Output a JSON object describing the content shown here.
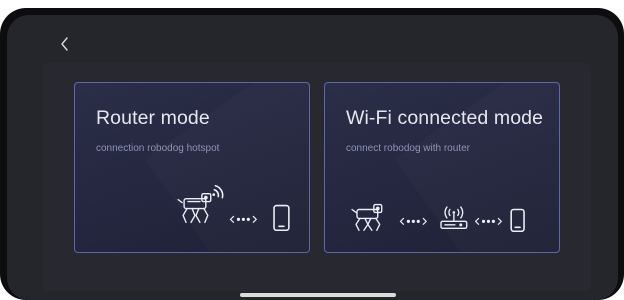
{
  "nav": {
    "back_icon": "chevron-left-icon"
  },
  "modes": [
    {
      "title": "Router mode",
      "subtitle": "connection robodog hotspot",
      "icons": [
        "robodog-icon",
        "wifi-signal-icon",
        "dotted-arrows-icon",
        "phone-icon"
      ]
    },
    {
      "title": "Wi-Fi connected mode",
      "subtitle": "connect robodog with router",
      "icons": [
        "robodog-icon",
        "dotted-arrows-icon",
        "router-icon",
        "dotted-arrows-icon",
        "phone-icon"
      ]
    }
  ],
  "colors": {
    "card_border": "#5d68a8",
    "card_bg": "#262842",
    "title": "#e6e7ee",
    "subtitle": "#8f93b3",
    "screen_bg": "#25262b"
  }
}
